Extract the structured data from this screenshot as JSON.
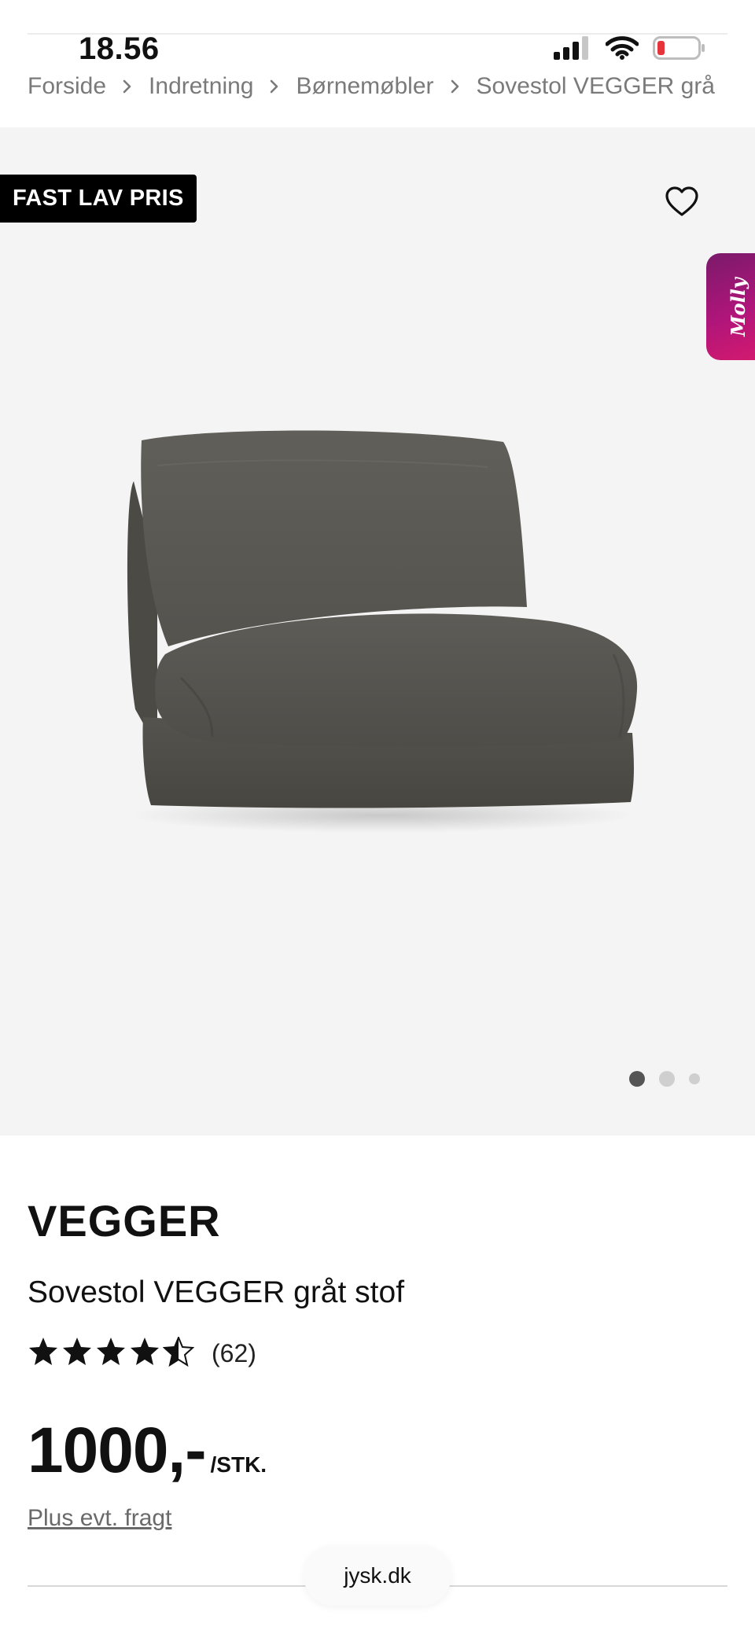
{
  "status_bar": {
    "time": "18.56",
    "battery_color": "#e5343a"
  },
  "breadcrumb": {
    "items": [
      "Forside",
      "Indretning",
      "Børnemøbler",
      "Sovestol VEGGER grå"
    ],
    "separator_icon": "chevron-right-icon"
  },
  "gallery": {
    "badge": "FAST LAV PRIS",
    "favorite_icon": "heart-outline-icon",
    "chat_tab_label": "Molly",
    "image_count": 3,
    "active_image": 1,
    "product_color": "#5a5853"
  },
  "product": {
    "brand": "VEGGER",
    "name": "Sovestol VEGGER gråt stof",
    "rating": 4.5,
    "rating_max": 5,
    "rating_count": "(62)",
    "price": "1000,-",
    "unit": "/STK.",
    "freight_note": "Plus evt. fragt"
  },
  "browser": {
    "url": "jysk.dk"
  }
}
